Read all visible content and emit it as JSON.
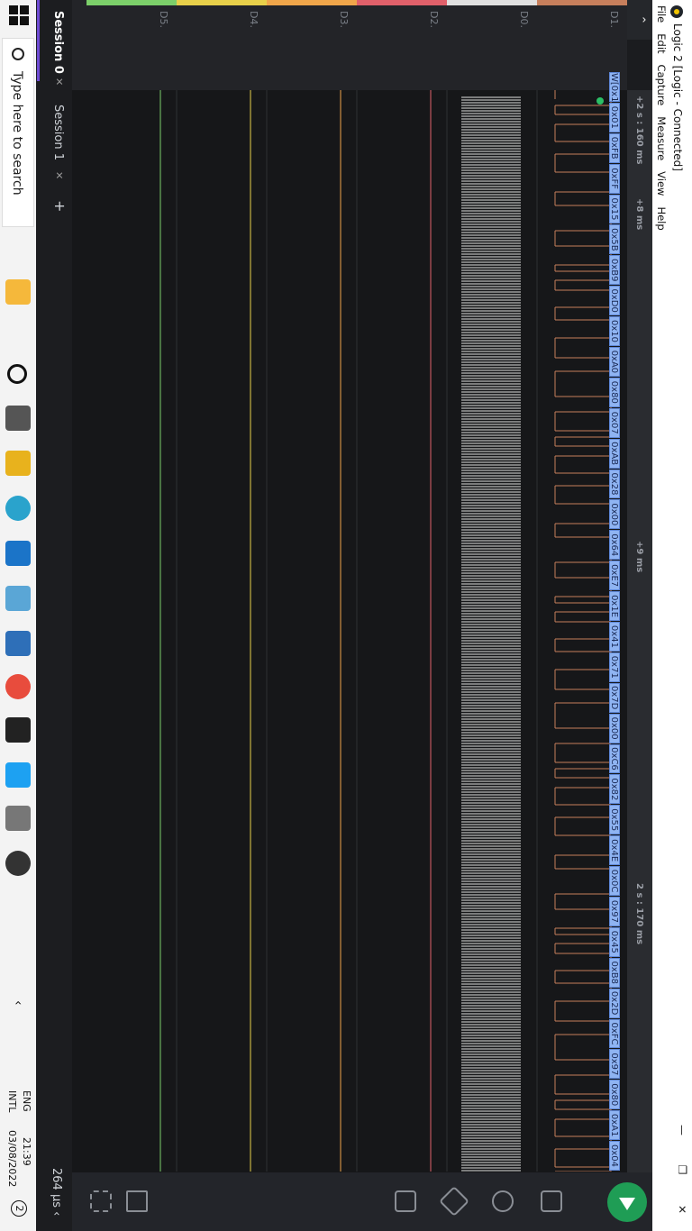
{
  "window": {
    "title": "Logic 2 [Logic - Connected]",
    "controls": {
      "close": "✕",
      "restore": "❐",
      "minimize": "—"
    }
  },
  "menu": [
    "File",
    "Edit",
    "Capture",
    "Measure",
    "View",
    "Help"
  ],
  "collapse_icon": "⌃",
  "time_axis": {
    "left_label": "+2 s : 160 ms",
    "labels": [
      "+8 ms",
      "+9 ms",
      "2 s : 170 ms"
    ]
  },
  "channels": [
    {
      "name": "D1.",
      "color": "#c77f5c"
    },
    {
      "name": "D0.",
      "color": "#e0e0e0"
    },
    {
      "name": "D2.",
      "color": "#e0606a"
    },
    {
      "name": "D3.",
      "color": "#f0a64a"
    },
    {
      "name": "D4.",
      "color": "#e8d04a"
    },
    {
      "name": "D5.",
      "color": "#7ccf6a"
    }
  ],
  "decoded_bytes": [
    "W[0x1",
    "0x01",
    "0xFB",
    "0xFF",
    "0x15",
    "0x5B",
    "0xB9",
    "0xD0",
    "0x10",
    "0xA0",
    "0x80",
    "0x07",
    "0xAB",
    "0x28",
    "0x00",
    "0x64",
    "0xE7",
    "0x1E",
    "0x41",
    "0x71",
    "0x7D",
    "0x00",
    "0xC6",
    "0x82",
    "0x55",
    "0x4E",
    "0x0C",
    "0x97",
    "0x45",
    "0xB8",
    "0x2D",
    "0xFC",
    "0x97",
    "0x80",
    "0xA1",
    "0x04"
  ],
  "sidebar": {
    "play_icon": "play-icon",
    "timing_readout": "264 µs ‹"
  },
  "sessions": {
    "tabs": [
      {
        "label": "Session 0",
        "close": "✕"
      },
      {
        "label": "Session 1",
        "close": "✕"
      }
    ],
    "add": "+"
  },
  "taskbar": {
    "search_placeholder": "Type here to search",
    "time": "21:39",
    "date": "03/08/2022",
    "lang": "ENG",
    "layout": "INTL",
    "notification_count": "2"
  }
}
